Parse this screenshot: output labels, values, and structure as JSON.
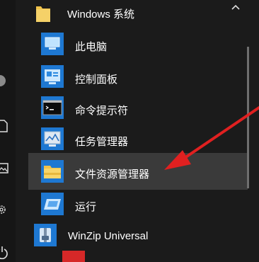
{
  "group": {
    "label": "Windows 系统",
    "expanded": true,
    "icon": "folder-icon"
  },
  "items": [
    {
      "label": "此电脑",
      "icon": "computer-icon"
    },
    {
      "label": "控制面板",
      "icon": "control-panel-icon"
    },
    {
      "label": "命令提示符",
      "icon": "command-prompt-icon"
    },
    {
      "label": "任务管理器",
      "icon": "task-manager-icon"
    },
    {
      "label": "文件资源管理器",
      "icon": "file-explorer-icon",
      "highlighted": true
    },
    {
      "label": "运行",
      "icon": "run-icon"
    }
  ],
  "next_app": {
    "label": "WinZip Universal",
    "icon": "winzip-icon"
  },
  "rail_icons": [
    "user-avatar-icon",
    "document-icon",
    "pictures-icon",
    "settings-icon",
    "power-icon"
  ],
  "colors": {
    "background": "#1b1b1b",
    "tile_blue": "#1e78d2",
    "highlight": "#3a3a3a",
    "annotation_arrow": "#e02020"
  }
}
